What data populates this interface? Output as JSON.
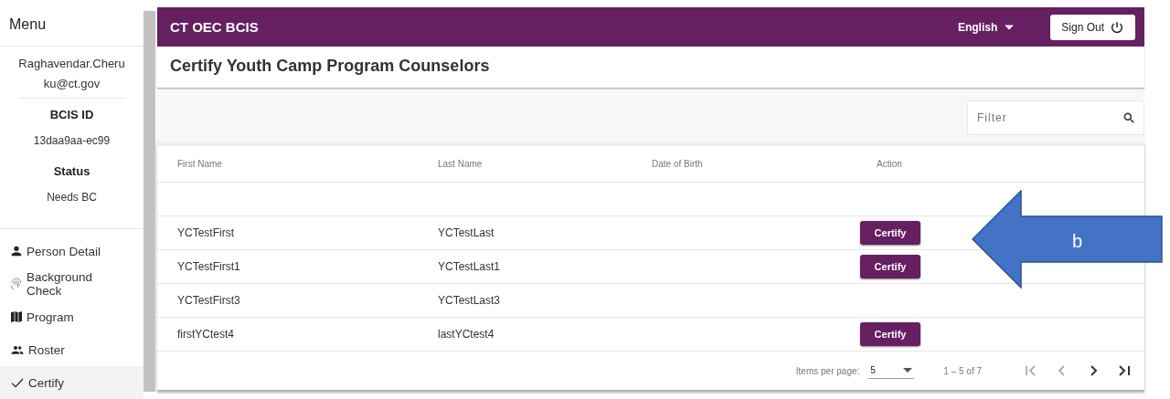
{
  "sidebar": {
    "title": "Menu",
    "user": "Raghavendar.Cheruku@ct.gov",
    "fields": [
      {
        "label": "BCIS ID",
        "value": "13daa9aa-ec99"
      },
      {
        "label": "Status",
        "value": "Needs BC"
      }
    ],
    "items": [
      {
        "label": "Person Detail",
        "selected": false
      },
      {
        "label": "Background Check",
        "selected": false
      },
      {
        "label": "Program",
        "selected": false
      },
      {
        "label": "Roster",
        "selected": false
      },
      {
        "label": "Certify",
        "selected": true
      }
    ]
  },
  "header": {
    "title": "CT OEC BCIS",
    "language": "English",
    "sign_out": "Sign Out"
  },
  "page_title": "Certify Youth Camp Program Counselors",
  "filter": {
    "placeholder": "Filter"
  },
  "table": {
    "columns": [
      "First Name",
      "Last Name",
      "Date of Birth",
      "Action"
    ],
    "rows": [
      {
        "first": "YCTestFirst",
        "last": "YCTestLast",
        "action": "Certify"
      },
      {
        "first": "YCTestFirst1",
        "last": "YCTestLast1",
        "action": "Certify"
      },
      {
        "first": "YCTestFirst3",
        "last": "YCTestLast3"
      },
      {
        "first": "firstYCtest4",
        "last": "lastYCtest4",
        "action": "Certify"
      }
    ]
  },
  "paginator": {
    "label": "Items per page:",
    "page_size": "5",
    "range": "1 – 5 of 7"
  },
  "annotation": {
    "label": "b"
  }
}
